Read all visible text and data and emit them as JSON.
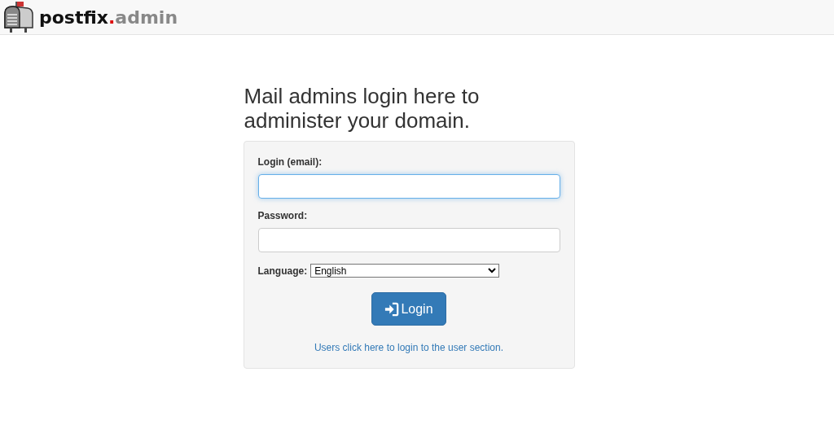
{
  "header": {
    "logo": {
      "name": "postfix",
      "dot": ".",
      "suffix": "admin"
    }
  },
  "heading": "Mail admins login here to administer your domain.",
  "form": {
    "fields": [
      {
        "label": "Login (email):",
        "focused": true
      },
      {
        "label": "Password:",
        "focused": false
      }
    ],
    "language": {
      "label": "Language:",
      "value": "English"
    },
    "button": "Login",
    "link": "Users click here to login to the user section."
  }
}
